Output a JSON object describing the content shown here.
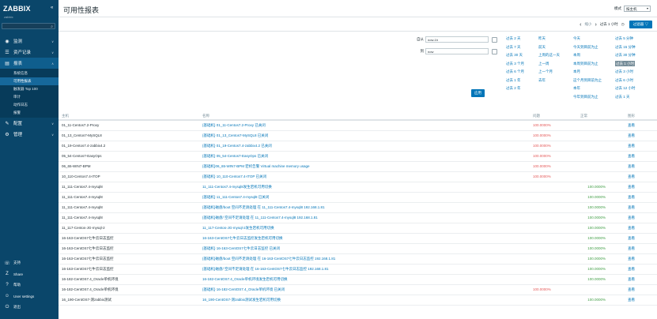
{
  "sidebar": {
    "logo": "ZABBIX",
    "logo_sub": "zabbix",
    "collapse": "«",
    "search_placeholder": "",
    "menu": [
      {
        "label": "监测",
        "icon": "eye-icon",
        "glyph": "◉"
      },
      {
        "label": "资产记录",
        "icon": "list-icon",
        "glyph": "☰"
      },
      {
        "label": "报表",
        "icon": "chart-icon",
        "glyph": "▤"
      }
    ],
    "reports_sub": [
      "系统信息",
      "可用性报表",
      "触发器 Top 100",
      "审计",
      "动作日志",
      "报警"
    ],
    "menu2": [
      {
        "label": "配置",
        "icon": "wrench-icon",
        "glyph": "✎"
      },
      {
        "label": "管理",
        "icon": "gear-icon",
        "glyph": "⚙"
      }
    ],
    "bottom": [
      {
        "label": "支持",
        "icon": "headset-icon",
        "glyph": "☏"
      },
      {
        "label": "Share",
        "icon": "share-icon",
        "glyph": "Z"
      },
      {
        "label": "帮助",
        "icon": "help-icon",
        "glyph": "?"
      },
      {
        "label": "User settings",
        "icon": "user-icon",
        "glyph": "☺"
      },
      {
        "label": "退出",
        "icon": "power-icon",
        "glyph": "⏻"
      }
    ]
  },
  "header": {
    "title": "可用性报表",
    "mode_label": "模式",
    "mode_value": "按主机"
  },
  "toolbar": {
    "prev": "‹",
    "zoom_out": "缩小",
    "next": "›",
    "period": "过去 1 小时",
    "clock": "◷",
    "filter": "过滤器"
  },
  "filter": {
    "from_label": "自从",
    "from_value": "now-1h",
    "to_label": "到",
    "to_value": "now",
    "apply": "应用",
    "quick_col1": [
      "过去 2 天",
      "过去 7 天",
      "过去 30 天",
      "过去 3 个月",
      "过去 6 个月",
      "过去 1 年",
      "过去 2 年"
    ],
    "quick_col2": [
      "昨天",
      "前天",
      "上周的这一天",
      "上一周",
      "上一个月",
      "去年"
    ],
    "quick_col3": [
      "今天",
      "今天到目前为止",
      "本周",
      "本周到目前为止",
      "本月",
      "这个月到目前为止",
      "本年",
      "今年到目前为止"
    ],
    "quick_col4": [
      "过去 5 分钟",
      "过去 15 分钟",
      "过去 30 分钟",
      "过去 1 小时",
      "过去 3 小时",
      "过去 6 小时",
      "过去 12 小时",
      "过去 1 天"
    ],
    "quick_selected": "过去 1 小时"
  },
  "table": {
    "headers": [
      "主机",
      "名称",
      "问题",
      "正常",
      "图形"
    ],
    "rows": [
      {
        "host": "01_11-Centos7.2-Proxy",
        "name": "{基础机} 01_11-Centos7.2-Proxy 已关闭",
        "problem": "100.0000%",
        "ok": "",
        "graph": "查看"
      },
      {
        "host": "01_13_Centos7-MySQL8",
        "name": "{基础机} 01_13_Centos7-MySQL8 已关闭",
        "problem": "100.0000%",
        "ok": "",
        "graph": "查看"
      },
      {
        "host": "01_19-Centos7.4-zabbix4.2",
        "name": "{基础机} 01_19-Centos7.4-zabbix4.2 已关闭",
        "problem": "100.0000%",
        "ok": "",
        "graph": "查看"
      },
      {
        "host": "05_54-Centos7-EasyOps",
        "name": "{基础机} 05_54-Centos7-EasyOps 已关闭",
        "problem": "100.0000%",
        "ok": "",
        "graph": "查看"
      },
      {
        "host": "06_65-WIN7-BPM",
        "name": "{基础机}06_65-WIN7-BPM 宕机告警  Virtual machine memory usage",
        "problem": "100.0000%",
        "ok": "",
        "graph": "查看"
      },
      {
        "host": "10_110-Centos7.4-ITOP",
        "name": "{基础机} 10_110-Centos7.4-ITOP 已关闭",
        "problem": "100.0000%",
        "ok": "",
        "graph": "查看"
      },
      {
        "host": "11_111-Centos7.4-mysql8",
        "name": "11_111-Centos7.4-mysql8发生宕机可用切换",
        "problem": "",
        "ok": "100.0000%",
        "graph": "查看"
      },
      {
        "host": "11_111-Centos7.4-mysql8",
        "name": "{基础机} 11_111-Centos7.4-mysql8 已关闭",
        "problem": "",
        "ok": "100.0000%",
        "graph": "查看"
      },
      {
        "host": "11_111-Centos7.4-mysql8",
        "name": "{基础机}磁盘/boot 空间不足请处理 在 11_111-Centos7.4-mysql8 192.168.1.81",
        "problem": "",
        "ok": "100.0000%",
        "graph": "查看"
      },
      {
        "host": "11_111-Centos7.4-mysql8",
        "name": "{基础机}磁盘/ 空间不足请处理 在 11_111-Centos7.4-mysql8 192.168.1.81",
        "problem": "",
        "ok": "100.0000%",
        "graph": "查看"
      },
      {
        "host": "11_117-Centos-JG-mysql-2",
        "name": "11_117-Centos-JG-mysql-2发生宕机可用切换",
        "problem": "",
        "ok": "100.0000%",
        "graph": "查看"
      },
      {
        "host": "16-163-CentOS7七牛云日志监控",
        "name": "16-163-CentOS7七牛云日志监控发生宕机可用切换",
        "problem": "",
        "ok": "100.0000%",
        "graph": "查看"
      },
      {
        "host": "16-163-CentOS7七牛云日志监控",
        "name": "{基础机} 16-163-CentOS7七牛云日志监控 已关闭",
        "problem": "",
        "ok": "100.0000%",
        "graph": "查看"
      },
      {
        "host": "16-163-CentOS7七牛云日志监控",
        "name": "{基础机}磁盘/boot 空间不足请处理 在 16-163-CentOS7七牛云日志监控 192.168.1.81",
        "problem": "",
        "ok": "100.0000%",
        "graph": "查看"
      },
      {
        "host": "16-163-CentOS7七牛云日志监控",
        "name": "{基础机}磁盘/ 空间不足请处理 在 16-163-CentOS7七牛云日志监控 192.168.1.81",
        "problem": "",
        "ok": "100.0000%",
        "graph": "查看"
      },
      {
        "host": "16-182-CentOS7.4_Oracle单机环境",
        "name": "16-182-CentOS7.4_Oracle单机环境发生宕机可用切换",
        "problem": "",
        "ok": "100.0000%",
        "graph": "查看"
      },
      {
        "host": "16-182-CentOS7.4_Oracle单机环境",
        "name": "{基础机} 16-182-CentOS7.4_Oracle单机环境 已关闭",
        "problem": "100.0000%",
        "ok": "",
        "graph": "查看"
      },
      {
        "host": "16_190-CentOS7-测zabbix测试",
        "name": "16_190-CentOS7-测zabbix测试发生宕机可用切换",
        "problem": "",
        "ok": "100.0000%",
        "graph": "查看"
      }
    ]
  }
}
